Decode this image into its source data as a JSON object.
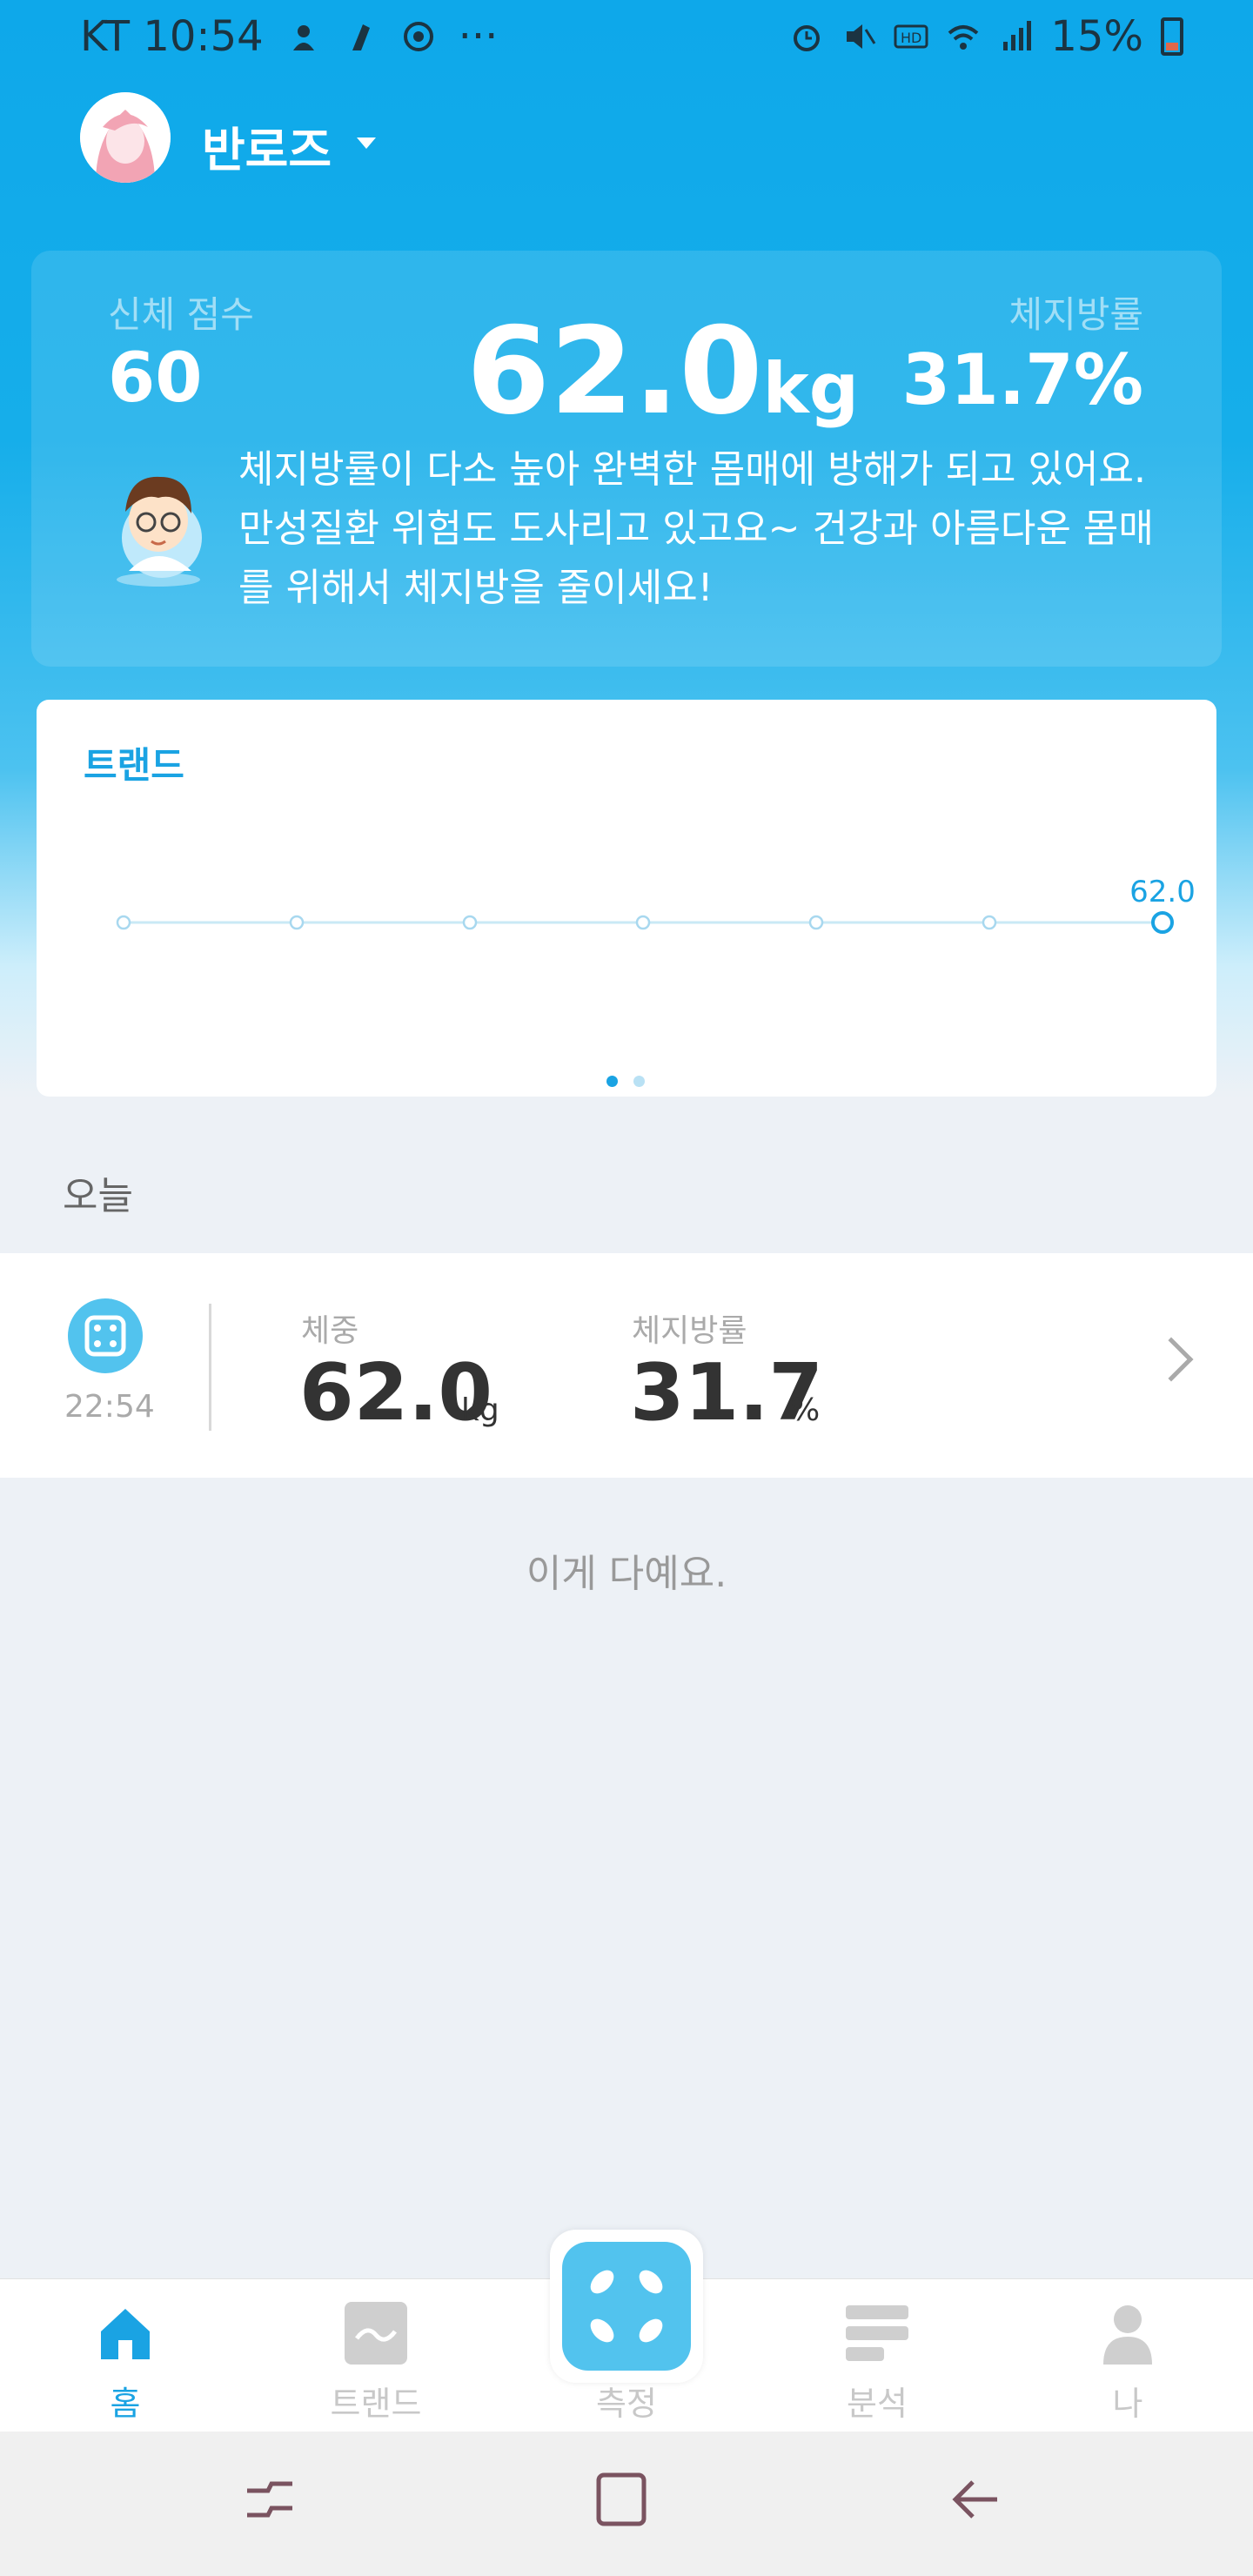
{
  "status_bar": {
    "carrier_time": "KT 10:54",
    "more": "···",
    "battery": "15%",
    "battery_level": 0.15
  },
  "header": {
    "username": "반로즈"
  },
  "summary": {
    "body_score_label": "신체 점수",
    "body_score": "60",
    "weight": "62.0",
    "weight_unit": "kg",
    "fat_label": "체지방률",
    "fat_value": "31.7%",
    "advice": "체지방률이 다소 높아 완벽한 몸매에 방해가 되고 있어요. 만성질환 위험도 도사리고 있고요~ 건강과 아름다운 몸매를 위해서 체지방을 줄이세요!"
  },
  "trend": {
    "title": "트랜드",
    "last_value_label": "62.0",
    "pages": 2,
    "active_page": 0
  },
  "chart_data": {
    "type": "line",
    "title": "트랜드",
    "series": [
      {
        "values": [
          null,
          null,
          null,
          null,
          null,
          null,
          62.0
        ]
      }
    ],
    "point_count": 7,
    "data_labels": [
      "62.0"
    ]
  },
  "today": {
    "label": "오늘"
  },
  "record": {
    "time": "22:54",
    "weight_label": "체중",
    "weight_value": "62.0",
    "weight_unit": "kg",
    "fat_label": "체지방률",
    "fat_value": "31.7",
    "fat_unit": "%"
  },
  "end_text": "이게 다예요.",
  "nav": {
    "home": "홈",
    "trend": "트랜드",
    "measure": "측정",
    "analysis": "분석",
    "me": "나"
  },
  "colors": {
    "accent": "#1aa3e3",
    "hero_top": "#0ea8ea",
    "scale_icon": "#52c3ee"
  }
}
